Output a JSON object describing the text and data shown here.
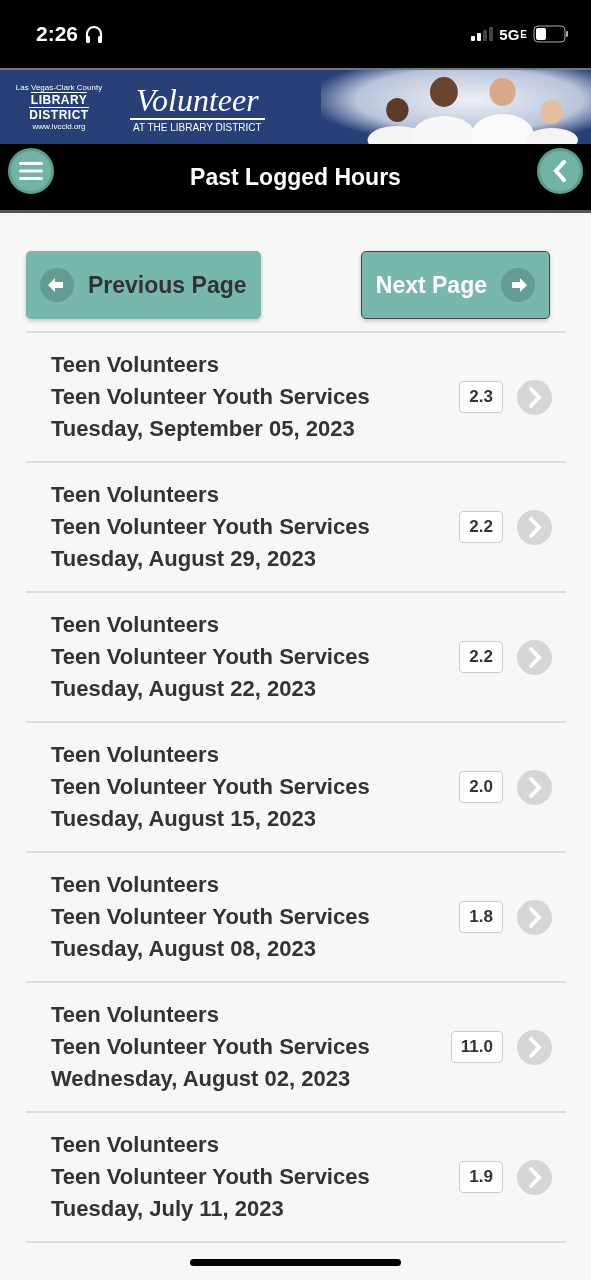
{
  "status_bar": {
    "time": "2:26",
    "network": "5G",
    "network_suffix": "E"
  },
  "banner": {
    "logo": {
      "top": "Las Vegas-Clark County",
      "line1": "LIBRARY",
      "line2": "DISTRICT",
      "url": "www.lvccld.org"
    },
    "title": "Volunteer",
    "subtitle": "AT THE LIBRARY DISTRICT"
  },
  "header": {
    "title": "Past Logged Hours"
  },
  "pager": [
    {
      "label": "Previous Page",
      "kind": "back",
      "focused": false
    },
    {
      "label": "Next Page",
      "kind": "forward",
      "focused": true
    }
  ],
  "entries": [
    {
      "group": "Teen Volunteers",
      "role": "Teen Volunteer Youth Services",
      "date": "Tuesday, September 05, 2023",
      "hours": "2.3"
    },
    {
      "group": "Teen Volunteers",
      "role": "Teen Volunteer Youth Services",
      "date": "Tuesday, August 29, 2023",
      "hours": "2.2"
    },
    {
      "group": "Teen Volunteers",
      "role": "Teen Volunteer Youth Services",
      "date": "Tuesday, August 22, 2023",
      "hours": "2.2"
    },
    {
      "group": "Teen Volunteers",
      "role": "Teen Volunteer Youth Services",
      "date": "Tuesday, August 15, 2023",
      "hours": "2.0"
    },
    {
      "group": "Teen Volunteers",
      "role": "Teen Volunteer Youth Services",
      "date": "Tuesday, August 08, 2023",
      "hours": "1.8"
    },
    {
      "group": "Teen Volunteers",
      "role": "Teen Volunteer Youth Services",
      "date": "Wednesday, August 02, 2023",
      "hours": "11.0"
    },
    {
      "group": "Teen Volunteers",
      "role": "Teen Volunteer Youth Services",
      "date": "Tuesday, July 11, 2023",
      "hours": "1.9"
    }
  ]
}
